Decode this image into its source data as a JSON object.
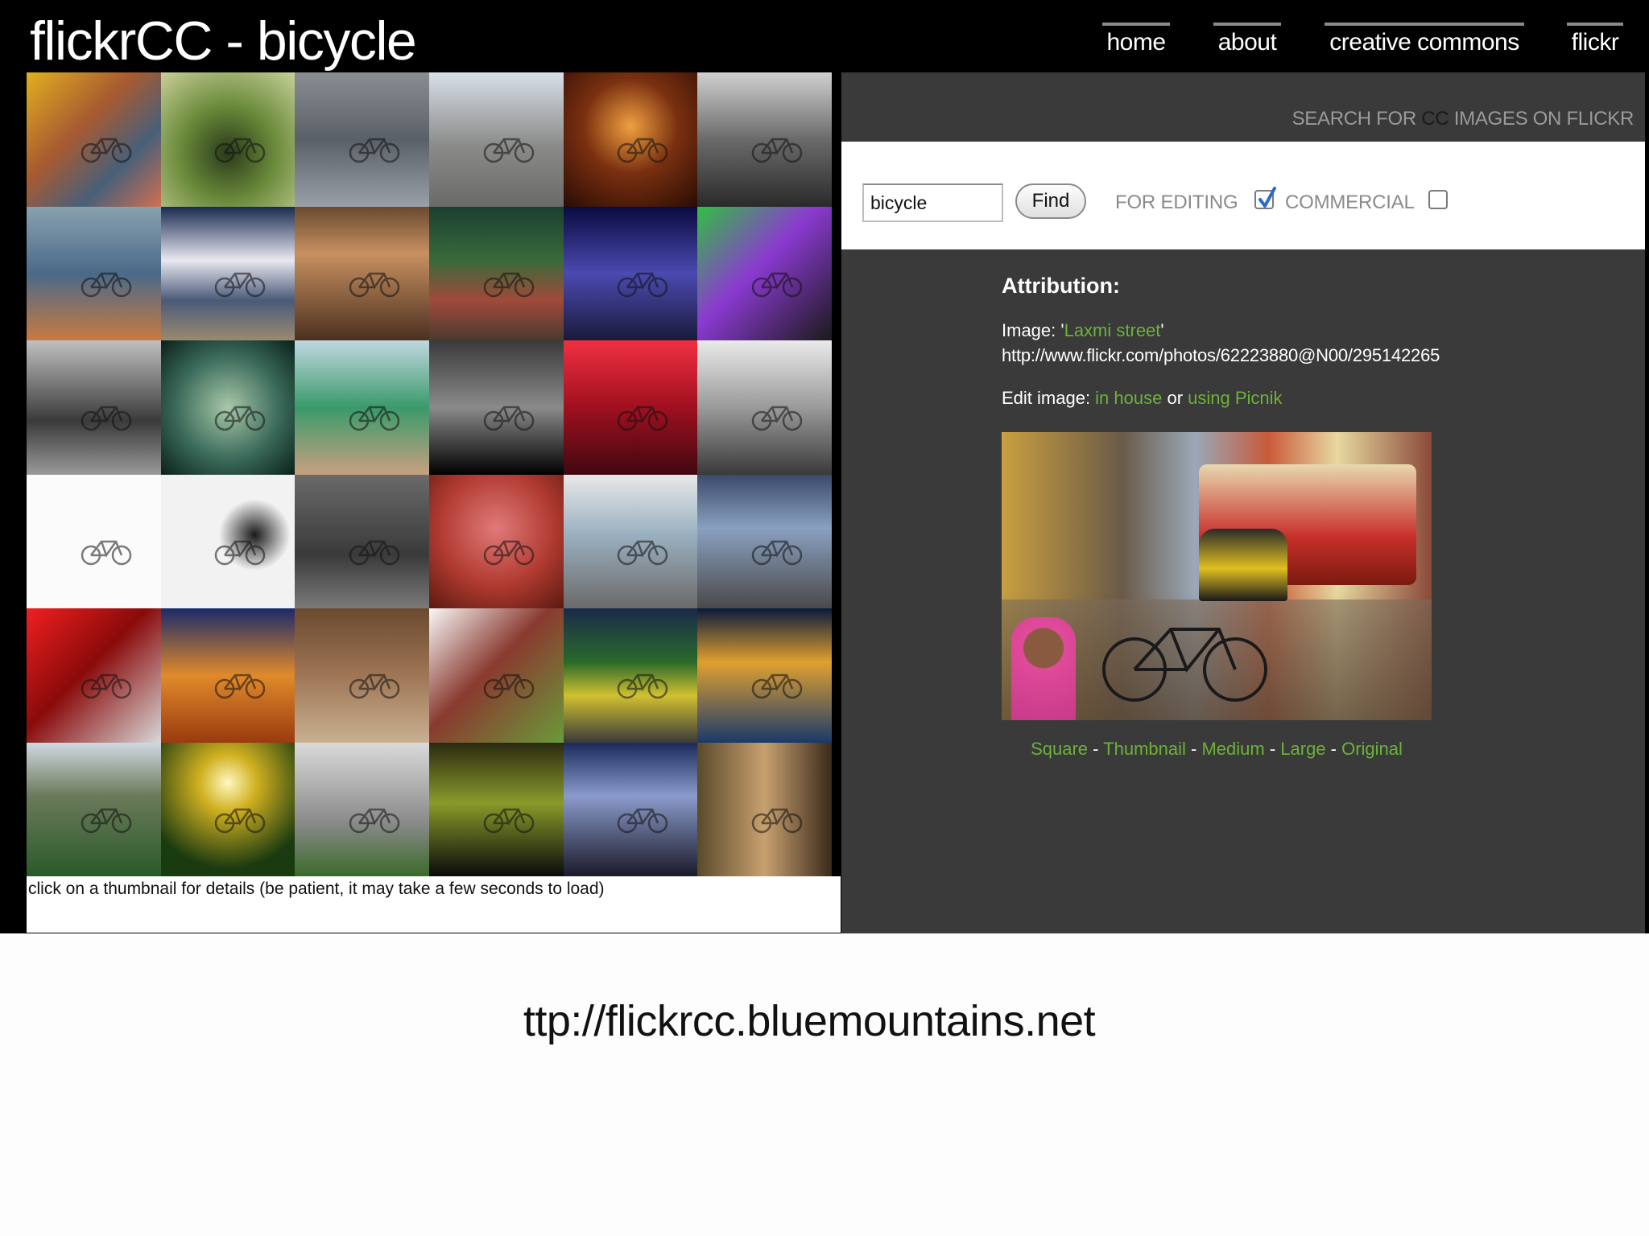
{
  "header": {
    "site_title": "flickrCC - bicycle",
    "nav": {
      "home": "home",
      "about": "about",
      "creative_commons": "creative commons",
      "flickr": "flickr"
    }
  },
  "grid": {
    "thumbnails": [
      "thumbnail-1",
      "thumbnail-2",
      "thumbnail-3",
      "thumbnail-4",
      "thumbnail-5",
      "thumbnail-6",
      "thumbnail-7",
      "thumbnail-8",
      "thumbnail-9",
      "thumbnail-10",
      "thumbnail-11",
      "thumbnail-12",
      "thumbnail-13",
      "thumbnail-14",
      "thumbnail-15",
      "thumbnail-16",
      "thumbnail-17",
      "thumbnail-18",
      "thumbnail-19",
      "thumbnail-20",
      "thumbnail-21",
      "thumbnail-22",
      "thumbnail-23",
      "thumbnail-24",
      "thumbnail-25",
      "thumbnail-26",
      "thumbnail-27",
      "thumbnail-28",
      "thumbnail-29",
      "thumbnail-30",
      "thumbnail-31",
      "thumbnail-32",
      "thumbnail-33",
      "thumbnail-34",
      "thumbnail-35",
      "thumbnail-36"
    ],
    "caption": "click on a thumbnail for details (be patient, it may take a few seconds to load)"
  },
  "search": {
    "label_prefix": "SEARCH FOR ",
    "label_cc": "CC",
    "label_suffix": " IMAGES ON FLICKR",
    "input_value": "bicycle",
    "find_label": "Find",
    "for_editing_label": "FOR EDITING",
    "for_editing_checked": true,
    "commercial_label": "COMMERCIAL",
    "commercial_checked": false
  },
  "attribution": {
    "heading": "Attribution:",
    "image_prefix": "Image: '",
    "image_title": "Laxmi street",
    "image_suffix": "'",
    "url": "http://www.flickr.com/photos/62223880@N00/295142265",
    "edit_prefix": "Edit image: ",
    "edit_in_house": "in house",
    "edit_or": " or ",
    "edit_picnik": "using Picnik",
    "sizes": [
      "Square",
      "Thumbnail",
      "Medium",
      "Large",
      "Original"
    ],
    "size_separator": " - "
  },
  "footer_url": "ttp://flickrcc.bluemountains.net",
  "colors": {
    "link_green": "#6cb23a",
    "panel_dark": "#3a3a3a",
    "page_black": "#000000"
  }
}
